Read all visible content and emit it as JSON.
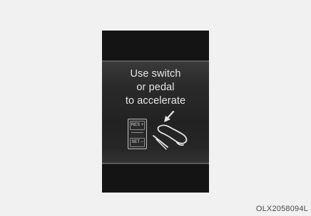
{
  "message": {
    "line1": "Use switch",
    "line2": "or pedal",
    "line3": "to accelerate"
  },
  "switch": {
    "res_label": "RES +",
    "set_label": "SET –"
  },
  "figure_code": "OLX2058094L",
  "colors": {
    "background": "#f1f1f1",
    "cluster": "#1b1b1b",
    "text": "#e6e6e6"
  },
  "icons": {
    "pedal": "foot-on-pedal-icon",
    "arrow": "press-arrow-icon",
    "switch": "res-set-switch-icon"
  }
}
